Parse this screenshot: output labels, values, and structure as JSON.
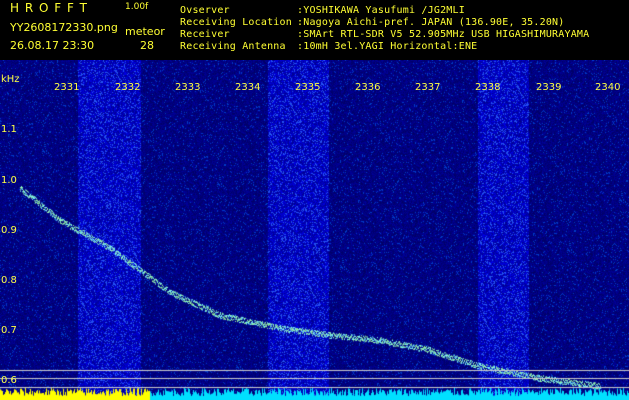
{
  "app": {
    "logo": "H R O F F T",
    "version": "1.00f",
    "filename": "YY2608172330.png",
    "datetime": "26.08.17 23:30",
    "mode_label": "meteor",
    "count": "28"
  },
  "info": {
    "observer_label": "Ovserver",
    "observer_value": ":YOSHIKAWA Yasufumi /JG2MLI",
    "location_label": "Receiving Location",
    "location_value": ":Nagoya Aichi-pref. JAPAN (136.90E, 35.20N)",
    "receiver_label": "Receiver",
    "receiver_value": ":SMArt RTL-SDR V5 52.905MHz USB HIGASHIMURAYAMA",
    "antenna_label": "Receiving Antenna",
    "antenna_value": ":10mH 3el.YAGI Horizontal:ENE"
  },
  "y_axis": {
    "unit": "kHz",
    "ticks": [
      "1.1",
      "1.0",
      "0.9",
      "0.8",
      "0.7",
      "0.6"
    ]
  },
  "x_axis": {
    "ticks": [
      "2331",
      "2332",
      "2333",
      "2334",
      "2335",
      "2336",
      "2337",
      "2338",
      "2339",
      "2340"
    ]
  },
  "colors": {
    "background": "#000000",
    "label_yellow": "#ffff33",
    "waterfall_base": "#00008c",
    "trace": "#80ffff",
    "level_bar_yellow": "#ffff00",
    "level_bar_cyan": "#00e0ff"
  }
}
